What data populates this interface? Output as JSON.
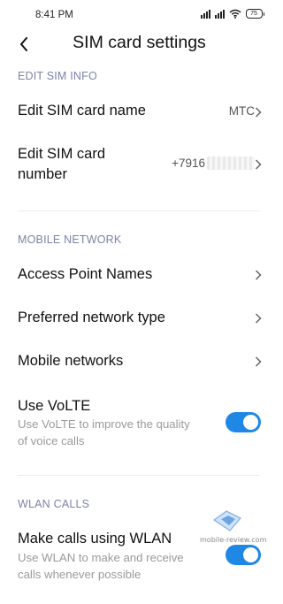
{
  "status_bar": {
    "time": "8:41 PM",
    "battery": "75"
  },
  "header": {
    "title": "SIM card settings"
  },
  "sections": {
    "edit_sim": {
      "header": "EDIT SIM INFO",
      "name_row": {
        "title": "Edit SIM card name",
        "value": "MTC"
      },
      "number_row": {
        "title_line1": "Edit SIM card",
        "title_line2": "number",
        "value": "+7916"
      }
    },
    "mobile_network": {
      "header": "MOBILE NETWORK",
      "apn_row": {
        "title": "Access Point Names"
      },
      "pref_row": {
        "title": "Preferred network type"
      },
      "mobile_row": {
        "title": "Mobile networks"
      },
      "volte": {
        "title": "Use VoLTE",
        "subtitle_line1": "Use VoLTE to improve the quality",
        "subtitle_line2": "of voice calls",
        "enabled": true
      }
    },
    "wlan_calls": {
      "header": "WLAN CALLS",
      "wlan": {
        "title": "Make calls using WLAN",
        "subtitle_line1": "Use WLAN to make and receive",
        "subtitle_line2": "calls whenever possible",
        "enabled": true
      }
    }
  },
  "watermark": {
    "text": "mobile-review.com"
  },
  "colors": {
    "accent": "#1f88e5",
    "section_header": "#7b83a8",
    "subtitle": "#9a9a9a"
  },
  "icons": {
    "back": "back-arrow-icon",
    "chevron": "chevron-right-icon",
    "signal": "signal-icon",
    "wifi": "wifi-icon",
    "battery": "battery-icon"
  }
}
